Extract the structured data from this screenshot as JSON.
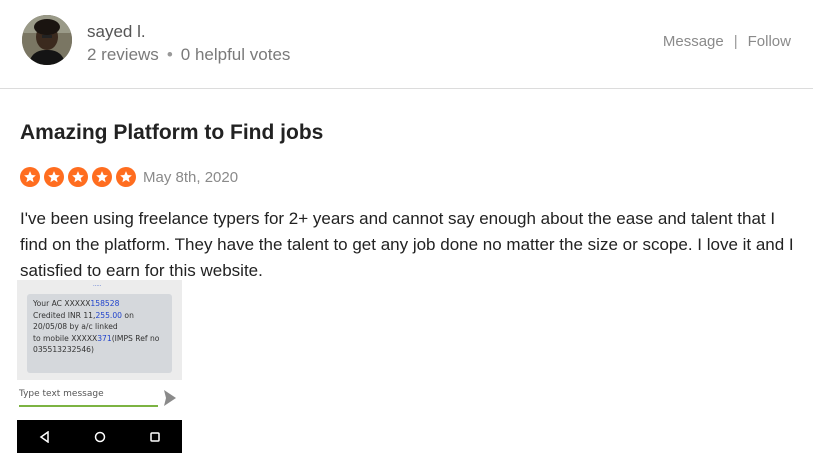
{
  "user": {
    "name": "sayed l.",
    "reviews": "2 reviews",
    "helpful_votes": "0 helpful votes",
    "separator": "•"
  },
  "actions": {
    "message_label": "Message",
    "separator": "|",
    "follow_label": "Follow"
  },
  "review": {
    "title": "Amazing Platform to Find jobs",
    "rating": 5,
    "date": "May 8th, 2020",
    "body": "I've been using freelance typers for 2+ years and cannot say enough about the ease and talent that I find on the platform. They have the talent to get any job done no matter the size or scope. I love it and I satisfied to earn for this website."
  },
  "attachment": {
    "sms_lines": [
      [
        "Your AC XXXXX",
        "158528",
        ""
      ],
      [
        "Credited INR 11,",
        "255.00",
        " on"
      ],
      [
        "20/05/08 by a/c linked",
        "",
        ""
      ],
      [
        "to mobile XXXXX",
        "371",
        "(IMPS Ref no"
      ],
      [
        "035513232546)",
        "",
        ""
      ]
    ],
    "input_placeholder": "Type text message"
  },
  "colors": {
    "star": "#ff6d1f",
    "input_underline": "#7cb342",
    "sms_highlight": "#2244cc"
  },
  "icons": [
    "avatar-photo",
    "star-icon",
    "send-icon",
    "back-icon",
    "home-icon",
    "recents-icon"
  ]
}
